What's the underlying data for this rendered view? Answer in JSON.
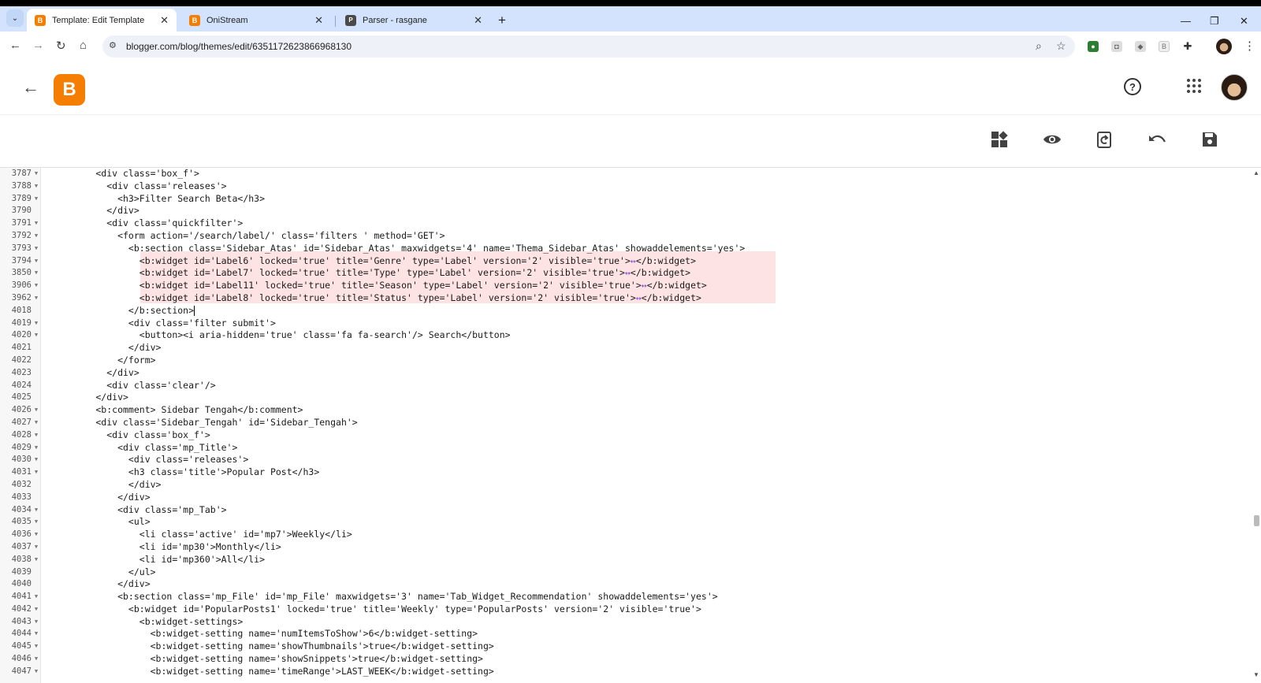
{
  "browser": {
    "tabs": [
      {
        "title": "Template: Edit Template",
        "active": true,
        "favicon": "blogger-icon"
      },
      {
        "title": "OniStream",
        "active": false,
        "favicon": "blogger-icon"
      },
      {
        "title": "Parser - rasgane",
        "active": false,
        "favicon": "parser-icon"
      }
    ],
    "new_tab": "+",
    "url": "blogger.com/blog/themes/edit/6351172623866968130",
    "window_controls": {
      "minimize": "—",
      "maximize": "❐",
      "close": "✕"
    }
  },
  "app": {
    "logo_letter": "B",
    "header_icons": [
      "back-arrow-icon",
      "help-icon",
      "apps-grid-icon",
      "account-avatar"
    ],
    "edit_toolbar": [
      "widgets-icon",
      "preview-eye-icon",
      "restore-icon",
      "undo-icon",
      "save-icon"
    ],
    "accent": "#f57d00",
    "highlight": "#fde3e3"
  },
  "editor": {
    "lines": [
      {
        "n": "3787",
        "f": true,
        "t": "        <div class='box_f'>"
      },
      {
        "n": "3788",
        "f": true,
        "t": "          <div class='releases'>"
      },
      {
        "n": "3789",
        "f": true,
        "t": "            <h3>Filter Search Beta</h3>"
      },
      {
        "n": "3790",
        "f": false,
        "t": "          </div>"
      },
      {
        "n": "3791",
        "f": true,
        "t": "          <div class='quickfilter'>"
      },
      {
        "n": "3792",
        "f": true,
        "t": "            <form action='/search/label/' class='filters ' method='GET'>"
      },
      {
        "n": "3793",
        "f": true,
        "t": "              <b:section class='Sidebar_Atas' id='Sidebar_Atas' maxwidgets='4' name='Thema_Sidebar_Atas' showaddelements='yes'>"
      },
      {
        "n": "3794",
        "f": true,
        "t": "                <b:widget id='Label6' locked='true' title='Genre' type='Label' version='2' visible='true'>↔</b:widget>",
        "hl": true
      },
      {
        "n": "3850",
        "f": true,
        "t": "                <b:widget id='Label7' locked='true' title='Type' type='Label' version='2' visible='true'>↔</b:widget>",
        "hl": true
      },
      {
        "n": "3906",
        "f": true,
        "t": "                <b:widget id='Label11' locked='true' title='Season' type='Label' version='2' visible='true'>↔</b:widget>",
        "hl": true
      },
      {
        "n": "3962",
        "f": true,
        "t": "                <b:widget id='Label8' locked='true' title='Status' type='Label' version='2' visible='true'>↔</b:widget>",
        "hl": true
      },
      {
        "n": "4018",
        "f": false,
        "t": "              </b:section>",
        "cursor": true
      },
      {
        "n": "4019",
        "f": true,
        "t": "              <div class='filter submit'>"
      },
      {
        "n": "4020",
        "f": true,
        "t": "                <button><i aria-hidden='true' class='fa fa-search'/> Search</button>"
      },
      {
        "n": "4021",
        "f": false,
        "t": "              </div>"
      },
      {
        "n": "4022",
        "f": false,
        "t": "            </form>"
      },
      {
        "n": "4023",
        "f": false,
        "t": "          </div>"
      },
      {
        "n": "4024",
        "f": false,
        "t": "          <div class='clear'/>"
      },
      {
        "n": "4025",
        "f": false,
        "t": "        </div>"
      },
      {
        "n": "4026",
        "f": true,
        "t": "        <b:comment> Sidebar Tengah</b:comment>"
      },
      {
        "n": "4027",
        "f": true,
        "t": "        <div class='Sidebar_Tengah' id='Sidebar_Tengah'>"
      },
      {
        "n": "4028",
        "f": true,
        "t": "          <div class='box_f'>"
      },
      {
        "n": "4029",
        "f": true,
        "t": "            <div class='mp_Title'>"
      },
      {
        "n": "4030",
        "f": true,
        "t": "              <div class='releases'>"
      },
      {
        "n": "4031",
        "f": true,
        "t": "              <h3 class='title'>Popular Post</h3>"
      },
      {
        "n": "4032",
        "f": false,
        "t": "              </div>"
      },
      {
        "n": "4033",
        "f": false,
        "t": "            </div>"
      },
      {
        "n": "4034",
        "f": true,
        "t": "            <div class='mp_Tab'>"
      },
      {
        "n": "4035",
        "f": true,
        "t": "              <ul>"
      },
      {
        "n": "4036",
        "f": true,
        "t": "                <li class='active' id='mp7'>Weekly</li>"
      },
      {
        "n": "4037",
        "f": true,
        "t": "                <li id='mp30'>Monthly</li>"
      },
      {
        "n": "4038",
        "f": true,
        "t": "                <li id='mp360'>All</li>"
      },
      {
        "n": "4039",
        "f": false,
        "t": "              </ul>"
      },
      {
        "n": "4040",
        "f": false,
        "t": "            </div>"
      },
      {
        "n": "4041",
        "f": true,
        "t": "            <b:section class='mp_File' id='mp_File' maxwidgets='3' name='Tab_Widget_Recommendation' showaddelements='yes'>"
      },
      {
        "n": "4042",
        "f": true,
        "t": "              <b:widget id='PopularPosts1' locked='true' title='Weekly' type='PopularPosts' version='2' visible='true'>"
      },
      {
        "n": "4043",
        "f": true,
        "t": "                <b:widget-settings>"
      },
      {
        "n": "4044",
        "f": true,
        "t": "                  <b:widget-setting name='numItemsToShow'>6</b:widget-setting>"
      },
      {
        "n": "4045",
        "f": true,
        "t": "                  <b:widget-setting name='showThumbnails'>true</b:widget-setting>"
      },
      {
        "n": "4046",
        "f": true,
        "t": "                  <b:widget-setting name='showSnippets'>true</b:widget-setting>"
      },
      {
        "n": "4047",
        "f": true,
        "t": "                  <b:widget-setting name='timeRange'>LAST_WEEK</b:widget-setting>"
      }
    ]
  }
}
